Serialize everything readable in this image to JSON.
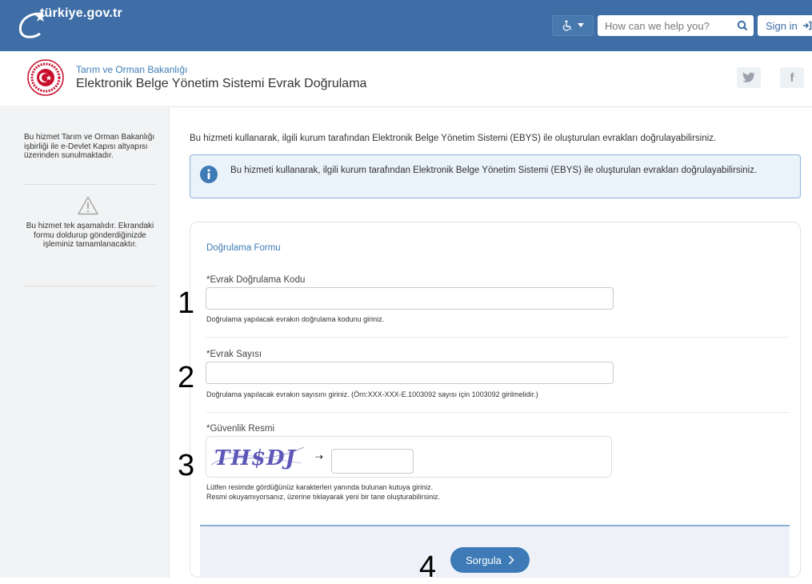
{
  "header": {
    "logo_text": "türkiye.gov.tr",
    "search_placeholder": "How can we help you?",
    "signin_label": "Sign in",
    "accessibility_icon": "wheelchair-icon",
    "colors": {
      "brand": "#3e6ea5",
      "accent": "#3e7bb6"
    }
  },
  "institution": {
    "ministry": "Tarım ve Orman Bakanlığı",
    "service_title": "Elektronik Belge Yönetim Sistemi Evrak Doğrulama",
    "social": [
      "twitter-icon",
      "facebook-icon"
    ]
  },
  "sidebar": {
    "notice": "Bu hizmet Tarım ve Orman Bakanlığı işbirliği ile e-Devlet Kapısı altyapısı üzerinden sunulmaktadır.",
    "warning": "Bu hizmet tek aşamalıdır. Ekrandaki formu doldurup gönderdiğinizde işleminiz tamamlanacaktır."
  },
  "main": {
    "intro": "Bu hizmeti kullanarak, ilgili kurum tarafından Elektronik Belge Yönetim Sistemi (EBYS) ile oluşturulan evrakları doğrulayabilirsiniz.",
    "info": "Bu hizmeti kullanarak, ilgili kurum tarafından Elektronik Belge Yönetim Sistemi (EBYS) ile oluşturulan evrakları doğrulayabilirsiniz."
  },
  "form": {
    "title": "Doğrulama Formu",
    "code_label": "*Evrak Doğrulama Kodu",
    "code_hint": "Doğrulama yapılacak evrakın doğrulama kodunu giriniz.",
    "number_label": "*Evrak Sayısı",
    "number_hint": "Doğrulama yapılacak evrakın sayısını giriniz. (Örn:XXX-XXX-E.1003092 sayısı için 1003092 girilmelidir.)",
    "captcha_label": "*Güvenlik Resmi",
    "captcha_text": "TH$DJ",
    "captcha_hint1": "Lütfen resimde gördüğünüz karakterleri yanında bulunan kutuya giriniz.",
    "captcha_hint2": "Resmi okuyamıyorsanız, üzerine tıklayarak yeni bir tane oluşturabilirsiniz.",
    "submit_label": "Sorgula"
  },
  "annotations": [
    "1",
    "2",
    "3",
    "4"
  ]
}
